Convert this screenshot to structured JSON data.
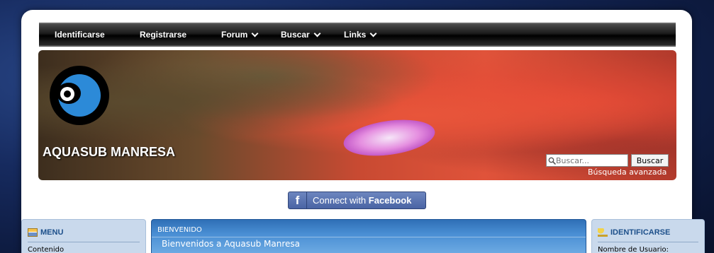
{
  "nav": {
    "items": [
      {
        "label": "Identificarse",
        "dropdown": false
      },
      {
        "label": "Registrarse",
        "dropdown": false
      },
      {
        "label": "Forum",
        "dropdown": true
      },
      {
        "label": "Buscar",
        "dropdown": true
      },
      {
        "label": "Links",
        "dropdown": true
      }
    ]
  },
  "banner": {
    "site_title": "AQUASUB MANRESA",
    "search_placeholder": "Buscar...",
    "search_button": "Buscar",
    "advanced_search": "Búsqueda avanzada"
  },
  "facebook": {
    "connect": "Connect",
    "with": "with",
    "brand": "Facebook",
    "icon": "facebook-f-icon"
  },
  "left_panel": {
    "title": "MENU",
    "icon": "menu-icon",
    "first_item": "Contenido"
  },
  "center_panel": {
    "label": "BIENVENIDO",
    "welcome": "Bienvenidos a Aquasub Manresa"
  },
  "right_panel": {
    "title": "IDENTIFICARSE",
    "icon": "key-icon",
    "first_field_label": "Nombre de Usuario:"
  },
  "colors": {
    "page_background": "#162a5e",
    "panel_blue": "#2f6fb6",
    "panel_light": "#c9d9ec",
    "facebook_blue": "#4a64a4"
  }
}
